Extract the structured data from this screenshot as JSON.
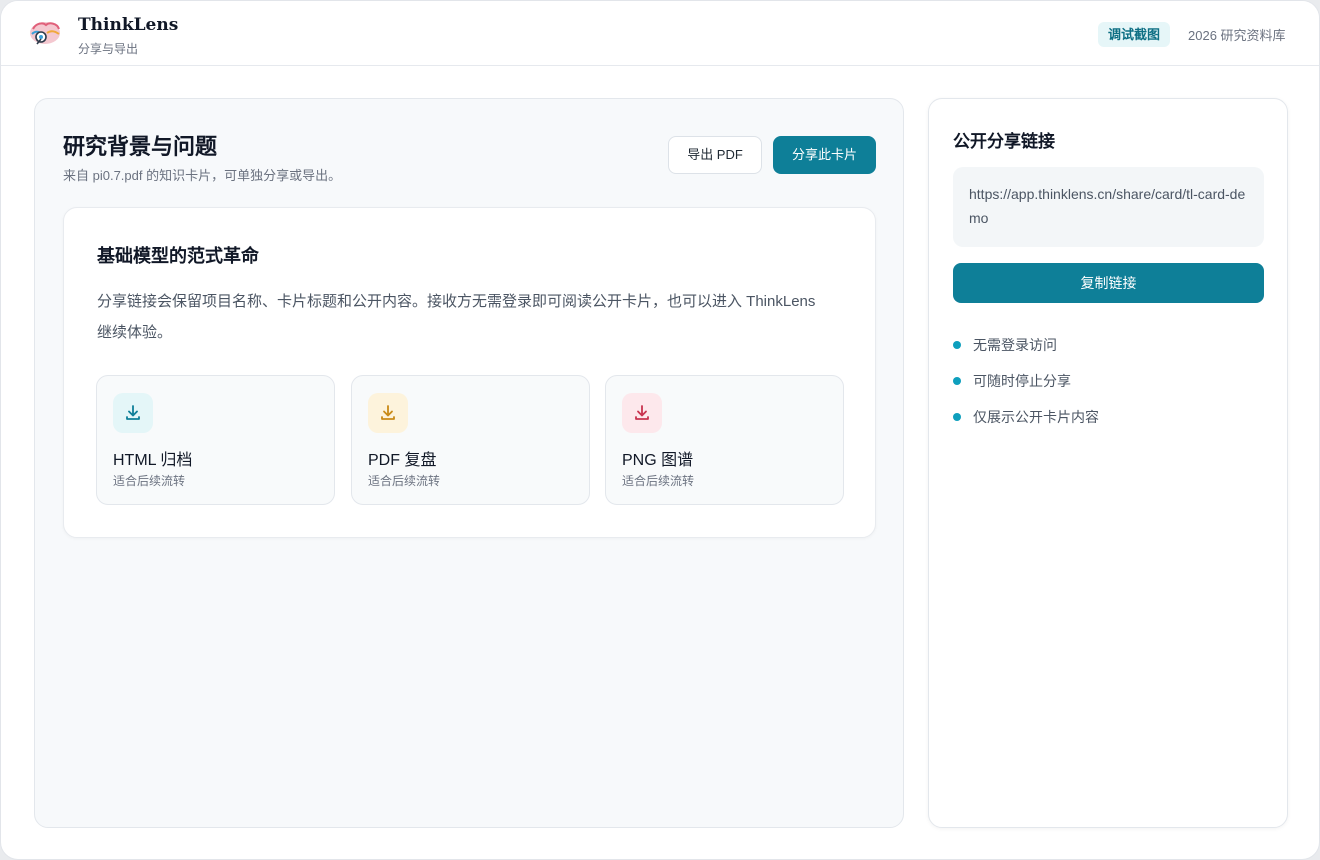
{
  "header": {
    "app_name": "ThinkLens",
    "subtitle": "分享与导出",
    "badge": "调试截图",
    "library": "2026 研究资料库"
  },
  "main": {
    "title": "研究背景与问题",
    "subtitle": "来自 pi0.7.pdf 的知识卡片，可单独分享或导出。",
    "export_pdf_label": "导出 PDF",
    "share_label": "分享此卡片",
    "card": {
      "title": "基础模型的范式革命",
      "body": "分享链接会保留项目名称、卡片标题和公开内容。接收方无需登录即可阅读公开卡片，也可以进入 ThinkLens 继续体验。",
      "tiles": [
        {
          "name": "HTML 归档",
          "desc": "适合后续流转",
          "icon": "download-icon",
          "color": "#0e7f98",
          "bg": "#e4f6f8"
        },
        {
          "name": "PDF 复盘",
          "desc": "适合后续流转",
          "icon": "download-icon",
          "color": "#c98a17",
          "bg": "#fdf3dc"
        },
        {
          "name": "PNG 图谱",
          "desc": "适合后续流转",
          "icon": "download-icon",
          "color": "#c8334f",
          "bg": "#fde8ec"
        }
      ]
    }
  },
  "side": {
    "title": "公开分享链接",
    "url": "https://app.thinklens.cn/share/card/tl-card-demo",
    "copy_label": "复制链接",
    "features": [
      "无需登录访问",
      "可随时停止分享",
      "仅展示公开卡片内容"
    ]
  },
  "colors": {
    "accent": "#0e7f98",
    "dot": "#0e9fbd"
  }
}
